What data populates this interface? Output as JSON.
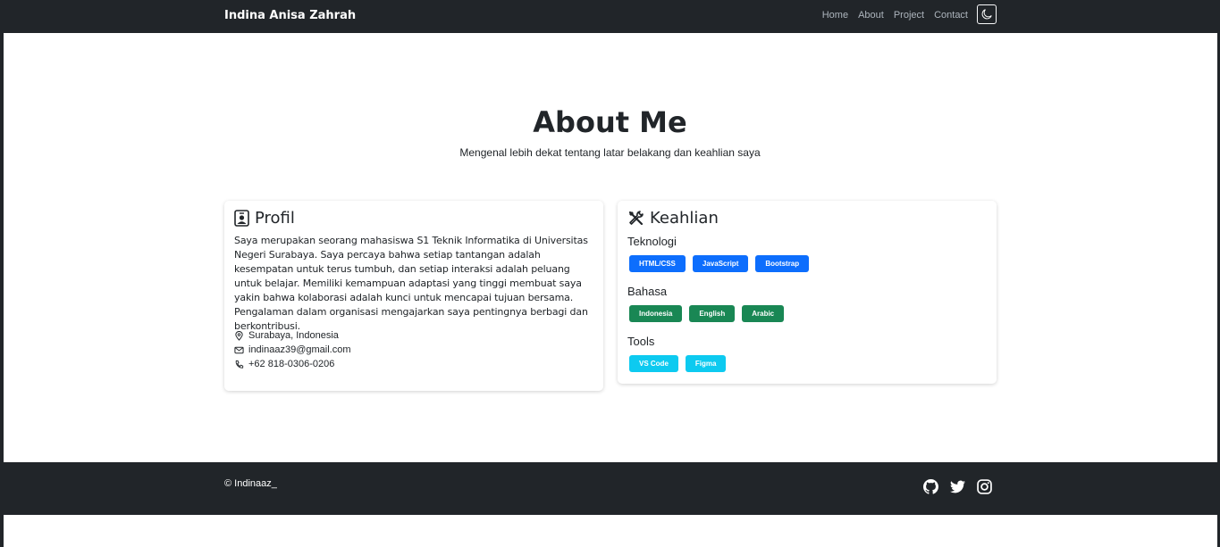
{
  "nav": {
    "brand": "Indina Anisa Zahrah",
    "links": [
      "Home",
      "About",
      "Project",
      "Contact"
    ],
    "theme_toggle_icon": "moon-icon"
  },
  "hero": {
    "title": "About Me",
    "subtitle": "Mengenal lebih dekat tentang latar belakang dan keahlian saya"
  },
  "profil": {
    "heading": "Profil",
    "icon": "person-badge-icon",
    "text": "Saya merupakan seorang mahasiswa S1 Teknik Informatika di Universitas Negeri Surabaya. Saya percaya bahwa setiap tantangan adalah kesempatan untuk terus tumbuh, dan setiap interaksi adalah peluang untuk belajar. Memiliki kemampuan adaptasi yang tinggi membuat saya yakin bahwa kolaborasi adalah kunci untuk mencapai tujuan bersama. Pengalaman dalam organisasi mengajarkan saya pentingnya berbagi dan berkontribusi.",
    "location": "Surabaya, Indonesia",
    "email": "indinaaz39@gmail.com",
    "phone": "+62 818-0306-0206"
  },
  "keahlian": {
    "heading": "Keahlian",
    "icon": "tools-icon",
    "groups": [
      {
        "label": "Teknologi",
        "items": [
          "HTML/CSS",
          "JavaScript",
          "Bootstrap"
        ],
        "color": "#0d6efd"
      },
      {
        "label": "Bahasa",
        "items": [
          "Indonesia",
          "English",
          "Arabic"
        ],
        "color": "#198754"
      },
      {
        "label": "Tools",
        "items": [
          "VS Code",
          "Figma"
        ],
        "color": "#0dcaf0"
      }
    ]
  },
  "footer": {
    "copyright": "© Indinaaz_",
    "socials": [
      "github-icon",
      "twitter-icon",
      "instagram-icon"
    ]
  }
}
